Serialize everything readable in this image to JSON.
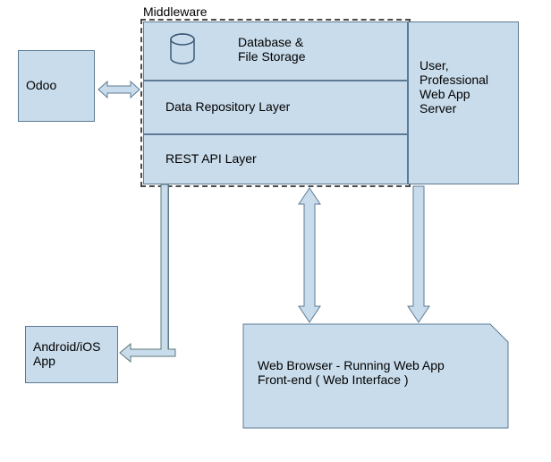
{
  "labels": {
    "middleware": "Middleware",
    "odoo": "Odoo"
  },
  "middleware": {
    "db": "Database &\nFile Storage",
    "repo": "Data Repository Layer",
    "rest": "REST API Layer"
  },
  "server": "User,\nProfessional\nWeb App\nServer",
  "app": "Android/iOS\nApp",
  "browser": "Web Browser - Running Web App\nFront-end ( Web Interface )"
}
